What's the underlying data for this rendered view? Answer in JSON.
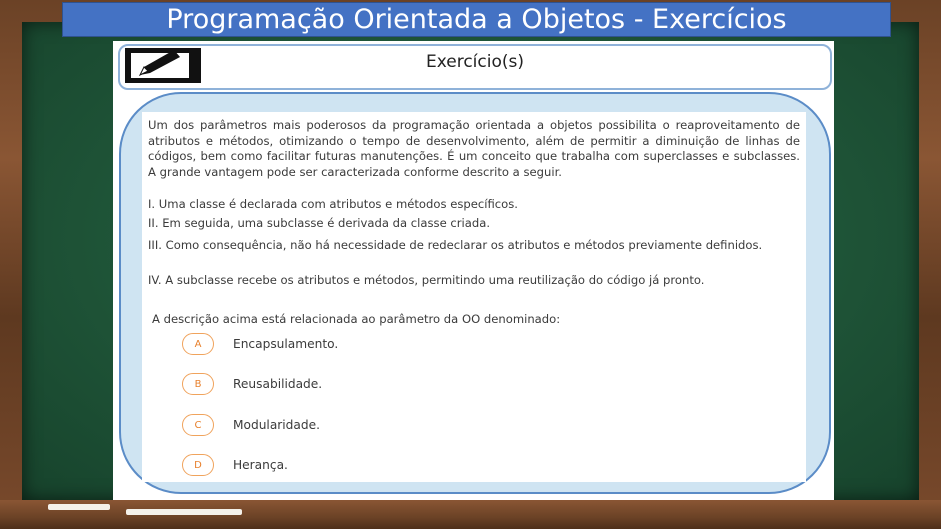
{
  "title": "Programação Orientada a Objetos - Exercícios",
  "header": {
    "label": "Exercício(s)",
    "icon": "pencil-notepad-icon"
  },
  "question": {
    "intro": "Um dos parâmetros mais poderosos da programação orientada a objetos possibilita o reaproveitamento de atributos e métodos, otimizando o tempo de desenvolvimento, além de permitir a diminuição de linhas de códigos, bem como facilitar futuras manutenções. É um conceito que trabalha com superclasses e subclasses. A grande vantagem pode ser caracterizada conforme descrito a seguir.",
    "item1": "I. Uma classe é declarada com atributos e métodos específicos.",
    "item2": "II. Em seguida, uma subclasse é derivada da classe criada.",
    "item3": "III. Como consequência, não há necessidade de redeclarar os atributos e métodos previamente definidos.",
    "item4": "IV. A subclasse recebe os atributos e métodos, permitindo uma reutilização do código já pronto.",
    "prompt": "A descrição acima está relacionada ao parâmetro da OO denominado:"
  },
  "options": [
    {
      "letter": "A",
      "label": "Encapsulamento."
    },
    {
      "letter": "B",
      "label": "Reusabilidade."
    },
    {
      "letter": "C",
      "label": "Modularidade."
    },
    {
      "letter": "D",
      "label": "Herança."
    }
  ],
  "colors": {
    "title_bar": "#4472c4",
    "board": "#1f5538",
    "frame": "#6b4226",
    "option_accent": "#f0a35c"
  }
}
